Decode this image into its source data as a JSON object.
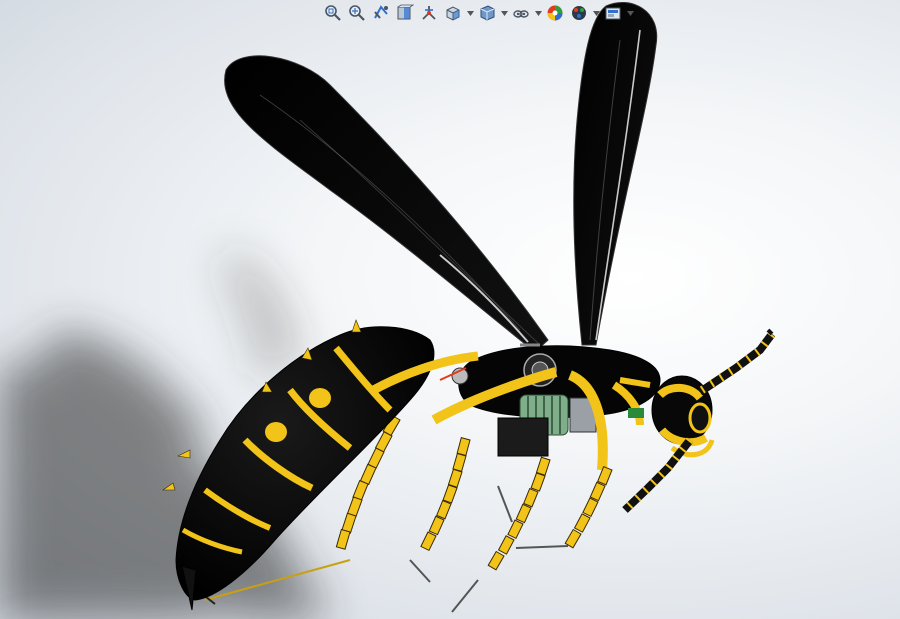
{
  "toolbar": {
    "items": [
      {
        "icon": "zoom-to-fit-icon",
        "dropdown": false
      },
      {
        "icon": "zoom-to-area-icon",
        "dropdown": false
      },
      {
        "icon": "previous-view-icon",
        "dropdown": false
      },
      {
        "icon": "section-view-icon",
        "dropdown": false
      },
      {
        "icon": "dynamic-annotation-views-icon",
        "dropdown": false
      },
      {
        "icon": "view-orientation-icon",
        "dropdown": true
      },
      {
        "icon": "display-style-icon",
        "dropdown": true
      },
      {
        "icon": "hide-show-items-icon",
        "dropdown": true
      },
      {
        "icon": "edit-appearance-icon",
        "dropdown": false
      },
      {
        "icon": "apply-scene-icon",
        "dropdown": true
      },
      {
        "icon": "view-settings-icon",
        "dropdown": true
      }
    ]
  },
  "colors": {
    "body_black": "#050505",
    "stripe_yellow": "#f2c318",
    "leg_outline": "#3a2a00",
    "background_light": "#f4f6f8",
    "background_edge": "#cfd6de"
  }
}
